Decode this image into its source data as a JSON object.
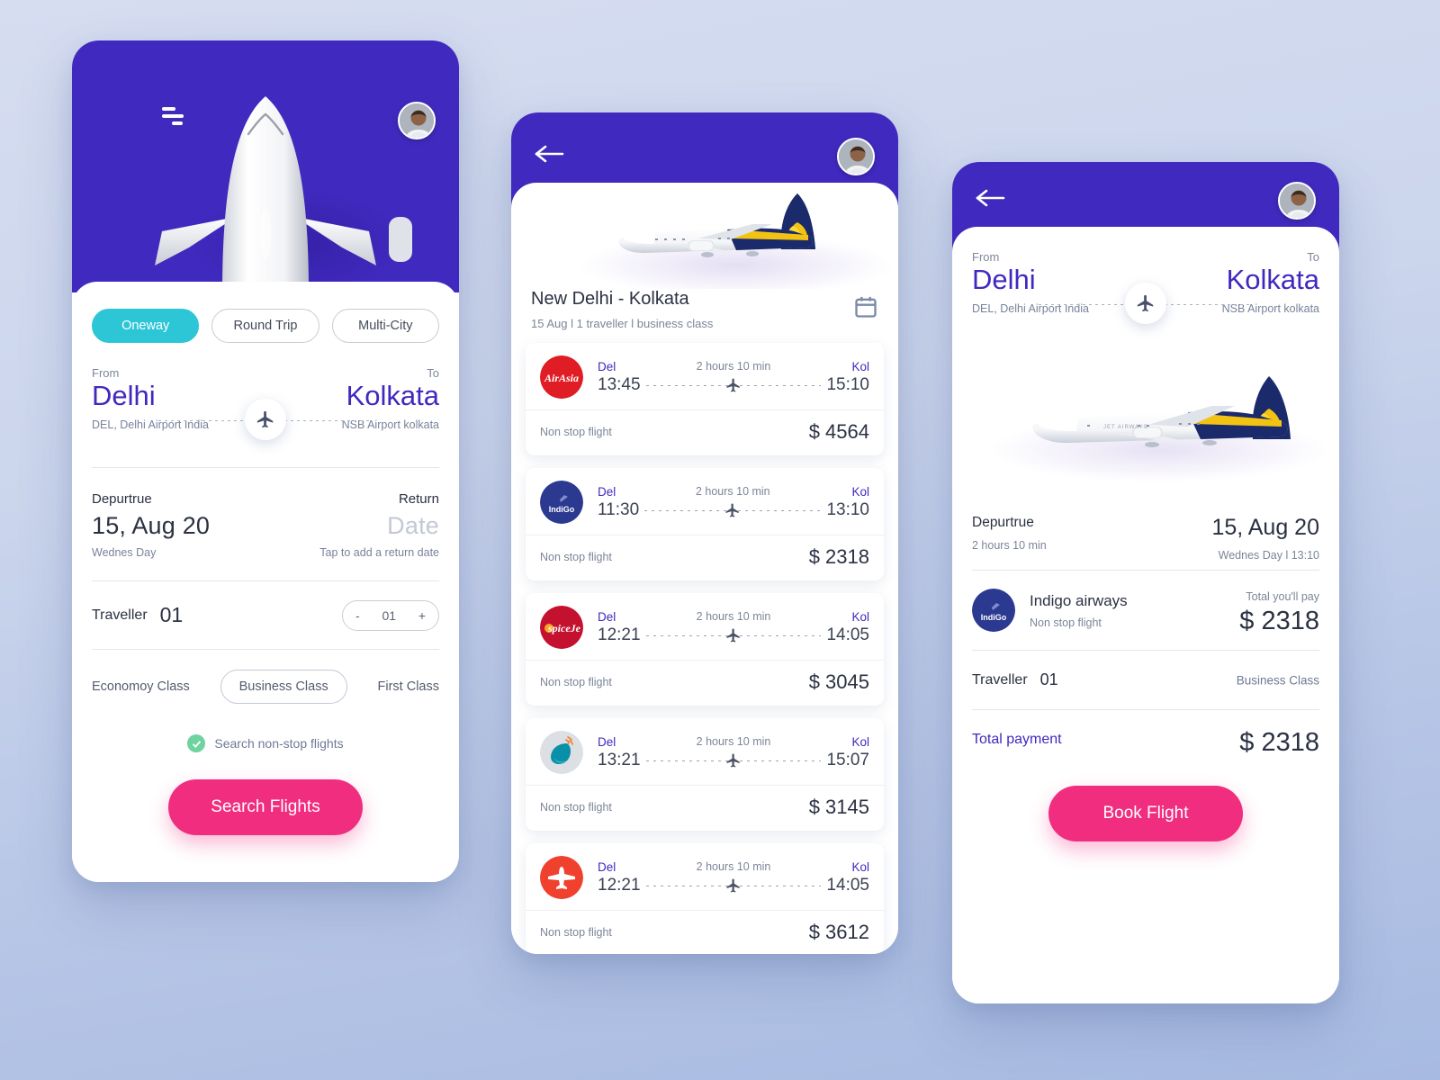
{
  "theme": {
    "purple": "#4029BE",
    "pink": "#F02D7F",
    "teal": "#2DC6D6",
    "green": "#6FD39F",
    "slate": "#7B8698"
  },
  "screen_search": {
    "menu_icon": "hamburger-icon",
    "avatar_icon": "user-avatar",
    "trip_tabs": [
      {
        "label": "Oneway",
        "active": true
      },
      {
        "label": "Round Trip",
        "active": false
      },
      {
        "label": "Multi-City",
        "active": false
      }
    ],
    "route": {
      "from_label": "From",
      "to_label": "To",
      "from_city": "Delhi",
      "to_city": "Kolkata",
      "from_airport": "DEL, Delhi Airport India",
      "to_airport": "NSB Airport kolkata",
      "plane_icon": "airplane-icon"
    },
    "dates": {
      "depart_label": "Depurtrue",
      "depart_value": "15, Aug 20",
      "depart_sub": "Wednes Day",
      "return_label": "Return",
      "return_value": "Date",
      "return_sub": "Tap to add a return date"
    },
    "traveller": {
      "label": "Traveller",
      "value": "01",
      "minus": "-",
      "count": "01",
      "plus": "+"
    },
    "classes": [
      {
        "label": "Economoy Class",
        "selected": false
      },
      {
        "label": "Business Class",
        "selected": true
      },
      {
        "label": "First Class",
        "selected": false
      }
    ],
    "nonstop": {
      "label": "Search non-stop flights",
      "checked": true,
      "icon": "check-circle-icon"
    },
    "cta": "Search Flights"
  },
  "screen_results": {
    "back_icon": "back-arrow-icon",
    "avatar_icon": "user-avatar",
    "title": "New Delhi  - Kolkata",
    "meta": "15 Aug l 1 traveller l business class",
    "calendar_icon": "calendar-icon",
    "flights": [
      {
        "airline": "AirAsia",
        "logo": "airasia-logo",
        "from_code": "Del",
        "to_code": "Kol",
        "depart": "13:45",
        "arrive": "15:10",
        "duration": "2 hours 10 min",
        "stops": "Non stop flight",
        "price": "$ 4564"
      },
      {
        "airline": "IndiGo",
        "logo": "indigo-logo",
        "from_code": "Del",
        "to_code": "Kol",
        "depart": "11:30",
        "arrive": "13:10",
        "duration": "2 hours 10 min",
        "stops": "Non stop flight",
        "price": "$ 2318"
      },
      {
        "airline": "SpiceJet",
        "logo": "spicejet-logo",
        "from_code": "Del",
        "to_code": "Kol",
        "depart": "12:21",
        "arrive": "14:05",
        "duration": "2 hours 10 min",
        "stops": "Non stop flight",
        "price": "$ 3045"
      },
      {
        "airline": "GoAir",
        "logo": "goair-logo",
        "from_code": "Del",
        "to_code": "Kol",
        "depart": "13:21",
        "arrive": "15:07",
        "duration": "2 hours 10 min",
        "stops": "Non stop flight",
        "price": "$ 3145"
      },
      {
        "airline": "Air India Express",
        "logo": "airindia-express-logo",
        "from_code": "Del",
        "to_code": "Kol",
        "depart": "12:21",
        "arrive": "14:05",
        "duration": "2 hours 10 min",
        "stops": "Non stop flight",
        "price": "$ 3612"
      }
    ]
  },
  "screen_booking": {
    "back_icon": "back-arrow-icon",
    "avatar_icon": "user-avatar",
    "route": {
      "from_label": "From",
      "to_label": "To",
      "from_city": "Delhi",
      "to_city": "Kolkata",
      "from_airport": "DEL, Delhi Airport India",
      "to_airport": "NSB Airport kolkata",
      "plane_icon": "airplane-icon"
    },
    "depart": {
      "label": "Depurtrue",
      "duration": "2 hours 10 min",
      "date": "15, Aug 20",
      "day_time": "Wednes Day l 13:10"
    },
    "airline": {
      "logo": "indigo-logo",
      "name": "Indigo airways",
      "stops": "Non stop flight",
      "total_label": "Total you'll pay",
      "total_amount": "$ 2318"
    },
    "traveller": {
      "label": "Traveller",
      "value": "01",
      "class": "Business Class"
    },
    "total": {
      "label": "Total payment",
      "amount": "$ 2318"
    },
    "cta": "Book Flight"
  }
}
